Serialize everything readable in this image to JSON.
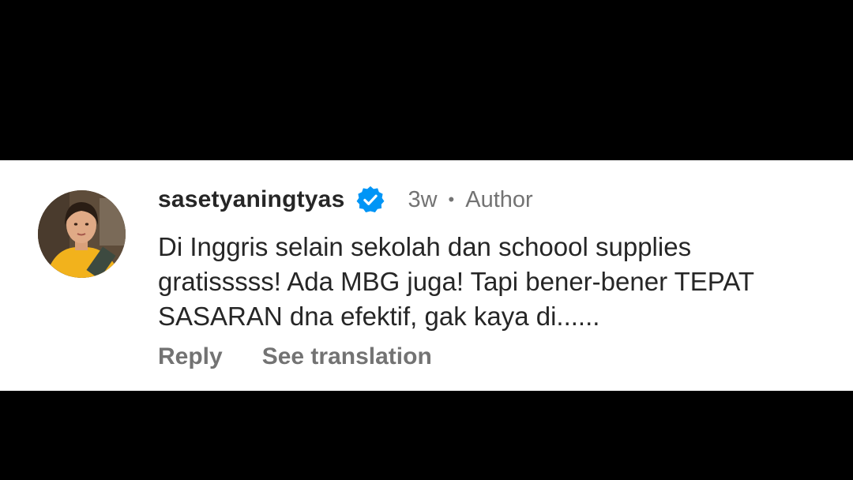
{
  "comment": {
    "username": "sasetyaningtyas",
    "verified_icon": "verified-badge-icon",
    "timestamp": "3w",
    "separator": "•",
    "role_label": "Author",
    "text": "Di Inggris selain sekolah dan schoool supplies gratisssss! Ada MBG juga! Tapi bener-bener TEPAT SASARAN dna efektif, gak kaya di......",
    "actions": {
      "reply_label": "Reply",
      "translate_label": "See translation"
    }
  },
  "colors": {
    "background": "#ffffff",
    "letterbox": "#000000",
    "primary_text": "#262626",
    "secondary_text": "#737373",
    "verified_blue": "#0095f6"
  }
}
